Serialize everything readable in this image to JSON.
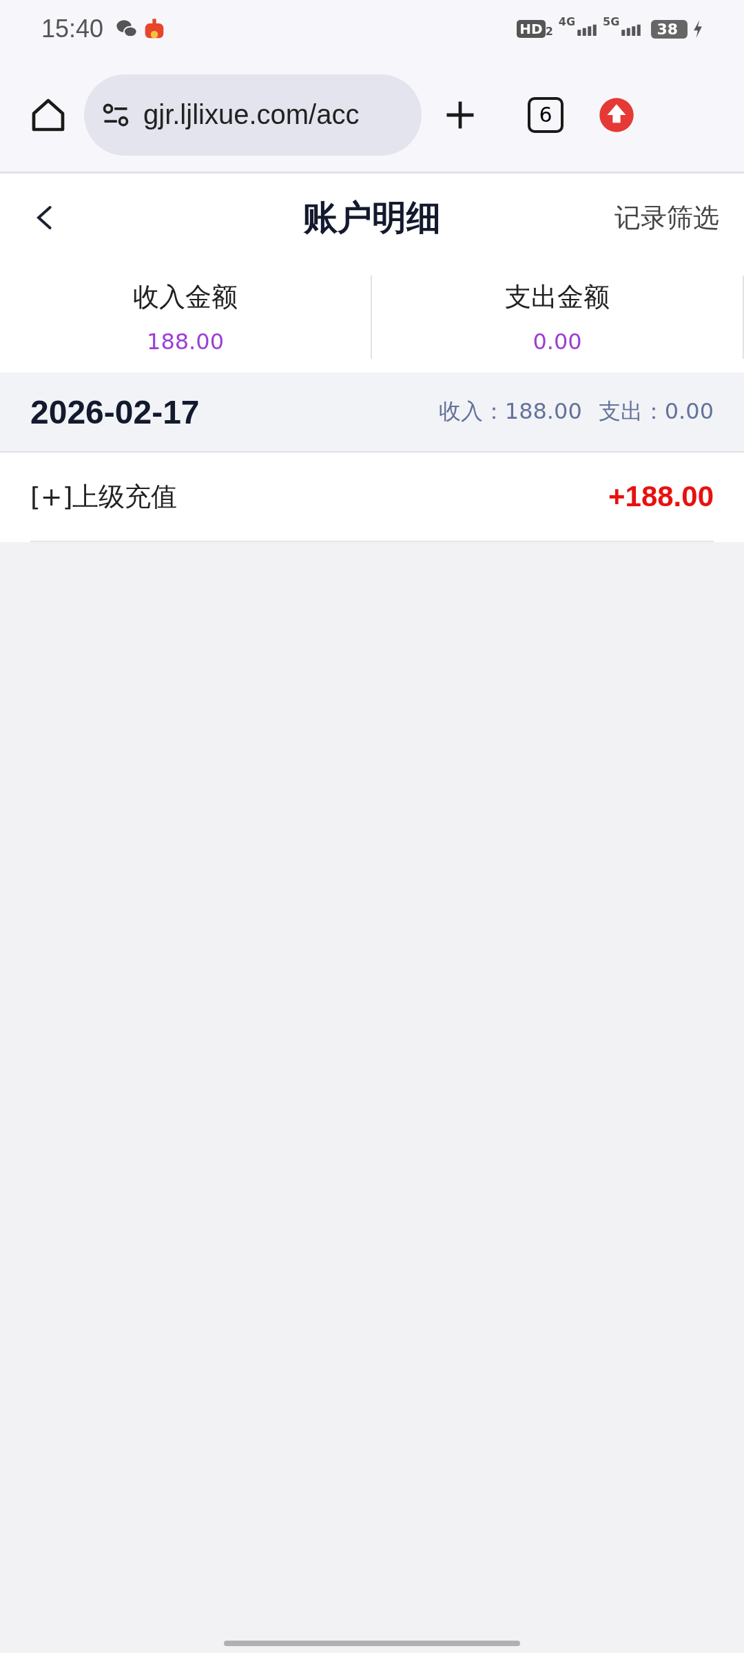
{
  "status_bar": {
    "time": "15:40",
    "hd": "HD",
    "hd_sub": "2",
    "net_1": "4G",
    "net_2": "5G",
    "battery": "38"
  },
  "browser": {
    "url": "gjr.ljlixue.com/acc",
    "tab_count": "6"
  },
  "header": {
    "title": "账户明细",
    "action": "记录筛选"
  },
  "summary": [
    {
      "label": "收入金额",
      "value": "188.00"
    },
    {
      "label": "支出金额",
      "value": "0.00"
    }
  ],
  "groups": [
    {
      "date": "2026-02-17",
      "income": "收入：188.00",
      "expense": "支出：0.00",
      "records": [
        {
          "title": "[+]上级充值",
          "amount": "+188.00",
          "kind": "income"
        }
      ]
    }
  ]
}
